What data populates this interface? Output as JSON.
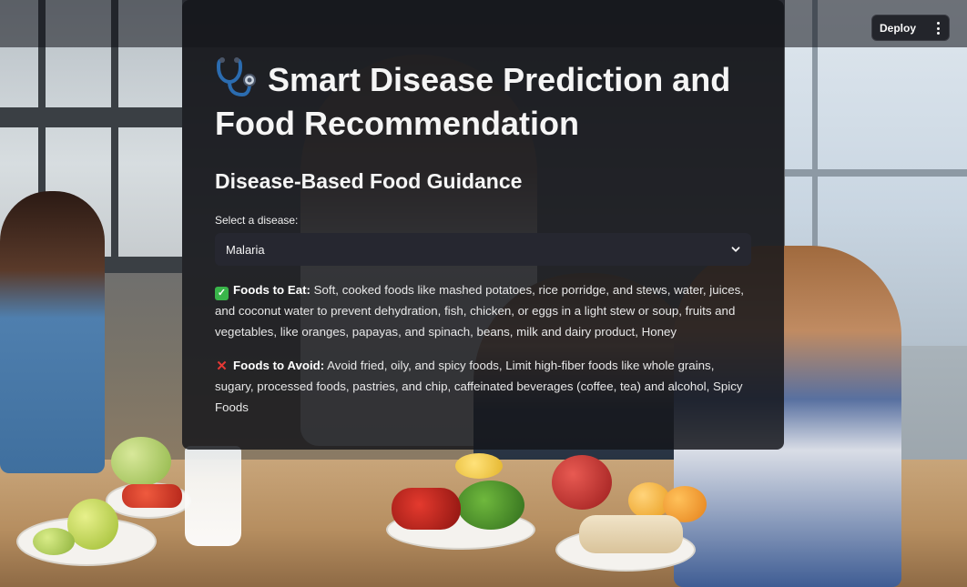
{
  "header": {
    "deploy_label": "Deploy",
    "menu_icon": "kebab-menu-icon"
  },
  "app": {
    "title_icon": "stethoscope-icon",
    "title": "Smart Disease Prediction and Food Recommendation",
    "subtitle": "Disease-Based Food Guidance",
    "select_label": "Select a disease:",
    "select_value": "Malaria",
    "eat": {
      "icon": "check-mark-icon",
      "label": "Foods to Eat:",
      "text": " Soft, cooked foods like mashed potatoes, rice porridge, and stews, water, juices, and coconut water to prevent dehydration, fish, chicken, or eggs in a light stew or soup, fruits and vegetables, like oranges, papayas, and spinach, beans, milk and dairy product, Honey"
    },
    "avoid": {
      "icon": "cross-mark-icon",
      "label": "Foods to Avoid:",
      "text": " Avoid fried, oily, and spicy foods, Limit high-fiber foods like whole grains, sugary, processed foods, pastries, and chip, caffeinated beverages (coffee, tea) and alcohol, Spicy Foods"
    }
  },
  "colors": {
    "card_bg": "#14151a",
    "select_bg": "#262730",
    "check_green": "#39b54a",
    "cross_red": "#e53935"
  }
}
